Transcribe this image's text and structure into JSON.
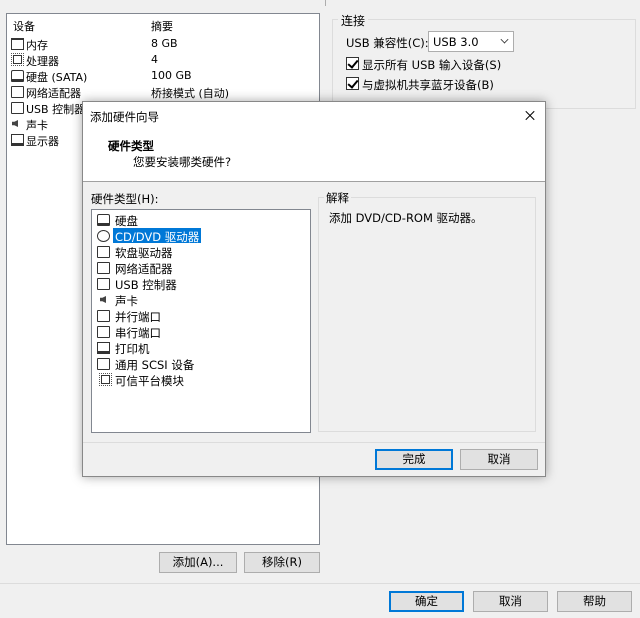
{
  "devices": {
    "col_device": "设备",
    "col_summary": "摘要",
    "rows": [
      {
        "name": "内存",
        "summary": "8 GB",
        "icon": "memory-icon"
      },
      {
        "name": "处理器",
        "summary": "4",
        "icon": "cpu-icon"
      },
      {
        "name": "硬盘 (SATA)",
        "summary": "100 GB",
        "icon": "hard-disk-icon"
      },
      {
        "name": "网络适配器",
        "summary": "桥接模式 (自动)",
        "icon": "network-adapter-icon"
      },
      {
        "name": "USB 控制器",
        "summary": "",
        "icon": "usb-controller-icon"
      },
      {
        "name": "声卡",
        "summary": "",
        "icon": "sound-card-icon"
      },
      {
        "name": "显示器",
        "summary": "",
        "icon": "display-icon"
      }
    ],
    "add_label": "添加(A)...",
    "remove_label": "移除(R)"
  },
  "connection": {
    "title": "连接",
    "usb_compat_label": "USB 兼容性(C):",
    "usb_compat_value": "USB 3.0",
    "show_all_usb_label": "显示所有 USB 输入设备(S)",
    "show_all_usb_checked": true,
    "share_bt_label": "与虚拟机共享蓝牙设备(B)",
    "share_bt_checked": true
  },
  "footer": {
    "ok_label": "确定",
    "cancel_label": "取消",
    "help_label": "帮助"
  },
  "wizard": {
    "title": "添加硬件向导",
    "heading": "硬件类型",
    "subheading": "您要安装哪类硬件?",
    "hw_type_label": "硬件类型(H):",
    "items": [
      {
        "label": "硬盘",
        "icon": "hard-disk-icon"
      },
      {
        "label": "CD/DVD 驱动器",
        "icon": "cd-dvd-icon"
      },
      {
        "label": "软盘驱动器",
        "icon": "floppy-icon"
      },
      {
        "label": "网络适配器",
        "icon": "network-adapter-icon"
      },
      {
        "label": "USB 控制器",
        "icon": "usb-controller-icon"
      },
      {
        "label": "声卡",
        "icon": "sound-card-icon"
      },
      {
        "label": "并行端口",
        "icon": "parallel-port-icon"
      },
      {
        "label": "串行端口",
        "icon": "serial-port-icon"
      },
      {
        "label": "打印机",
        "icon": "printer-icon"
      },
      {
        "label": "通用 SCSI 设备",
        "icon": "scsi-device-icon"
      },
      {
        "label": "可信平台模块",
        "icon": "tpm-icon"
      }
    ],
    "selected_index": 1,
    "explanation_title": "解释",
    "explanation_text": "添加 DVD/CD-ROM 驱动器。",
    "finish_label": "完成",
    "cancel_label": "取消"
  }
}
